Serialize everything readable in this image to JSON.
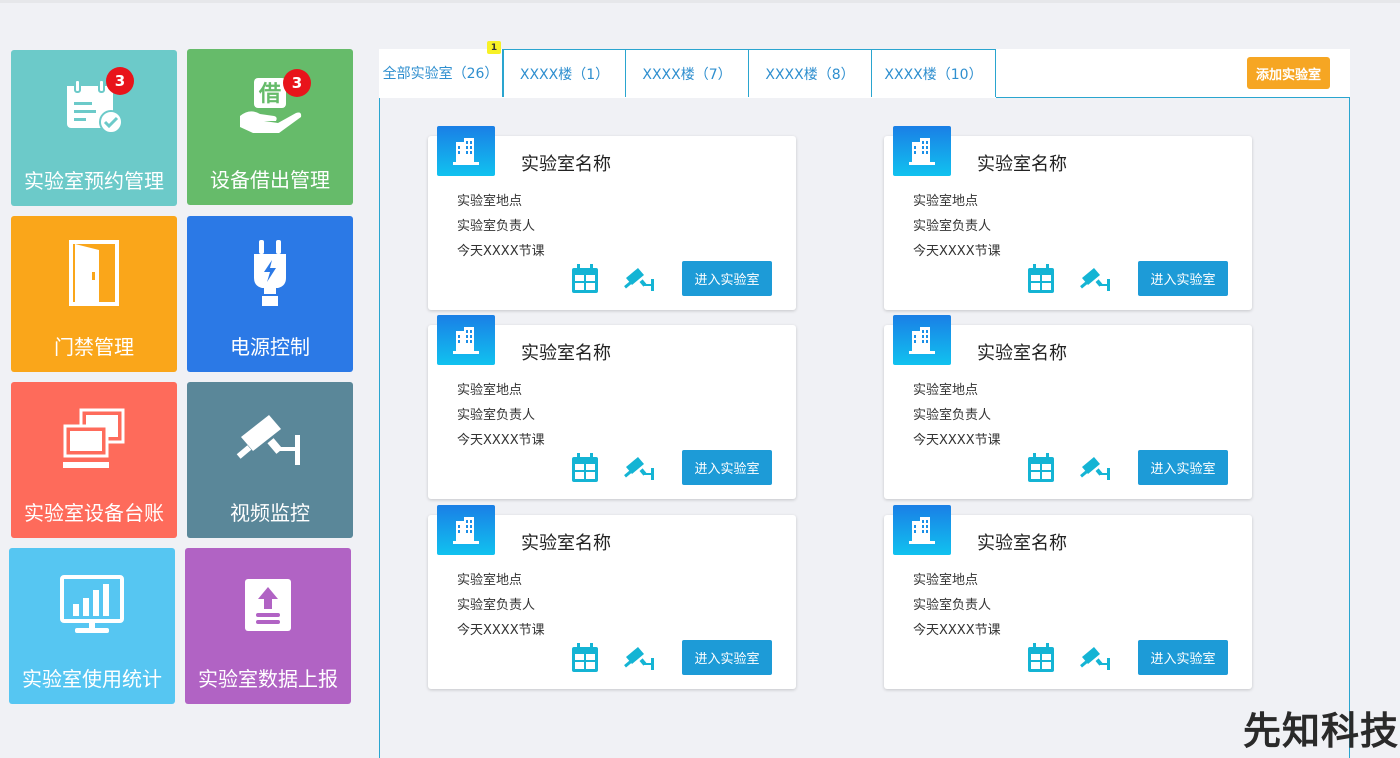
{
  "tiles": [
    {
      "label": "实验室预约管理",
      "color": "#6ccac9",
      "badge": "3",
      "icon": "calendar-check-icon"
    },
    {
      "label": "设备借出管理",
      "color": "#66bb6a",
      "badge": "3",
      "icon": "borrow-hand-icon"
    },
    {
      "label": "门禁管理",
      "color": "#faa61a",
      "badge": null,
      "icon": "door-icon"
    },
    {
      "label": "电源控制",
      "color": "#2b79e6",
      "badge": null,
      "icon": "power-plug-icon"
    },
    {
      "label": "实验室设备台账",
      "color": "#fe6b5b",
      "badge": null,
      "icon": "computer-icon"
    },
    {
      "label": "视频监控",
      "color": "#5a8799",
      "badge": null,
      "icon": "cctv-camera-icon"
    },
    {
      "label": "实验室使用统计",
      "color": "#56c6f2",
      "badge": null,
      "icon": "chart-monitor-icon"
    },
    {
      "label": "实验室数据上报",
      "color": "#b163c4",
      "badge": null,
      "icon": "upload-doc-icon"
    }
  ],
  "tabs": [
    {
      "label": "全部实验室（26）"
    },
    {
      "label": "XXXX楼（1）"
    },
    {
      "label": "XXXX楼（7）"
    },
    {
      "label": "XXXX楼（8）"
    },
    {
      "label": "XXXX楼（10）"
    }
  ],
  "tab_marker": "1",
  "add_button": "添加实验室",
  "cards": [
    {
      "name": "实验室名称",
      "location": "实验室地点",
      "manager": "实验室负责人",
      "today": "今天XXXX节课",
      "enter": "进入实验室"
    },
    {
      "name": "实验室名称",
      "location": "实验室地点",
      "manager": "实验室负责人",
      "today": "今天XXXX节课",
      "enter": "进入实验室"
    },
    {
      "name": "实验室名称",
      "location": "实验室地点",
      "manager": "实验室负责人",
      "today": "今天XXXX节课",
      "enter": "进入实验室"
    },
    {
      "name": "实验室名称",
      "location": "实验室地点",
      "manager": "实验室负责人",
      "today": "今天XXXX节课",
      "enter": "进入实验室"
    },
    {
      "name": "实验室名称",
      "location": "实验室地点",
      "manager": "实验室负责人",
      "today": "今天XXXX节课",
      "enter": "进入实验室"
    },
    {
      "name": "实验室名称",
      "location": "实验室地点",
      "manager": "实验室负责人",
      "today": "今天XXXX节课",
      "enter": "进入实验室"
    }
  ],
  "colors": {
    "accent": "#1d9bd7",
    "border": "#2aa5cf",
    "add": "#f6a623",
    "badge": "#e8141b"
  },
  "watermark": "先知科技"
}
